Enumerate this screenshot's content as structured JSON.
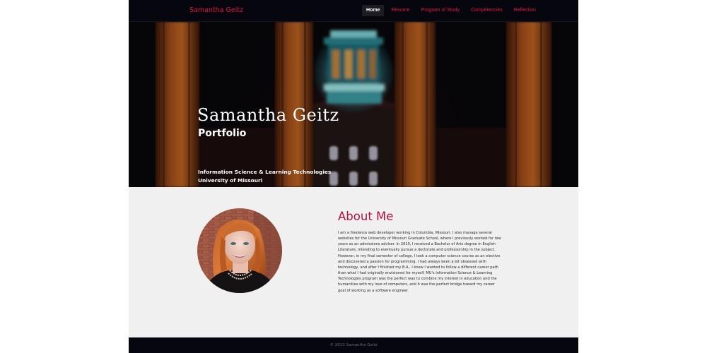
{
  "navbar": {
    "brand": "Samantha Geitz",
    "items": [
      {
        "label": "Home",
        "active": true
      },
      {
        "label": "Resume",
        "active": false
      },
      {
        "label": "Program of Study",
        "active": false
      },
      {
        "label": "Competencies",
        "active": false
      },
      {
        "label": "Reflection",
        "active": false
      }
    ]
  },
  "hero": {
    "title": "Samantha Geitz",
    "subtitle": "Portfolio",
    "program": "Information Science & Learning Technologies",
    "school": "University of Missouri"
  },
  "about": {
    "heading": "About Me",
    "body": "I am a freelance web developer working in Columbia, Missouri. I also manage several websites for the University of Missouri Graduate School, where I previously worked for two years as an admissions adviser. In 2010, I received a Bachelor of Arts degree in English Literature, intending to eventually pursue a doctorate and professorship in the subject. However, in my final semester of college, I took a computer science course as an elective and discovered a passion for programming. I had always been a bit obsessed with technology, and after I finished my B.A., I knew I wanted to follow a different career path than what I had originally envisioned for myself. MU's Information Science & Learning Technologies program was the perfect way to combine my interest in education and the humanities with my love of computers, and it was the perfect bridge toward my career goal of working as a software engineer."
  },
  "footer": {
    "copyright": "© 2013 Samantha Geitz"
  },
  "colors": {
    "accent": "#e0173d",
    "heading": "#b1123e",
    "navbar_bg": "#06060f",
    "content_bg": "#f0f0f0"
  }
}
